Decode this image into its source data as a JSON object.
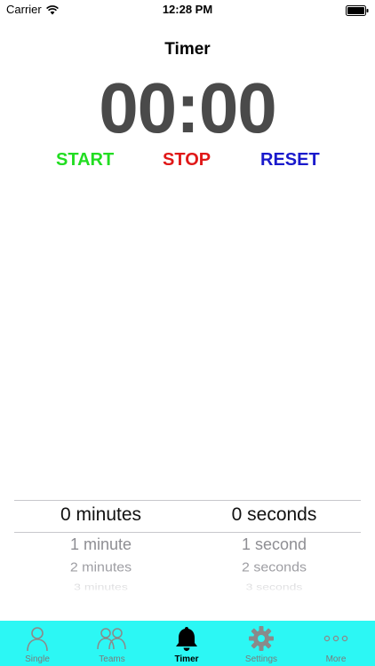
{
  "status_bar": {
    "carrier": "Carrier",
    "time": "12:28 PM"
  },
  "title": "Timer",
  "timer_display": "00:00",
  "controls": {
    "start": "START",
    "stop": "STOP",
    "reset": "RESET"
  },
  "picker": {
    "minutes": [
      "0 minutes",
      "1 minute",
      "2 minutes",
      "3 minutes"
    ],
    "seconds": [
      "0 seconds",
      "1 second",
      "2 seconds",
      "3 seconds"
    ]
  },
  "tabs": [
    {
      "label": "Single",
      "icon": "person-icon",
      "active": false
    },
    {
      "label": "Teams",
      "icon": "people-icon",
      "active": false
    },
    {
      "label": "Timer",
      "icon": "bell-icon",
      "active": true
    },
    {
      "label": "Settings",
      "icon": "gear-icon",
      "active": false
    },
    {
      "label": "More",
      "icon": "more-icon",
      "active": false
    }
  ],
  "colors": {
    "start": "#22dd22",
    "stop": "#e01818",
    "reset": "#1a1acc",
    "tab_bar": "#2cf7f4",
    "timer": "#4a4a4a"
  }
}
